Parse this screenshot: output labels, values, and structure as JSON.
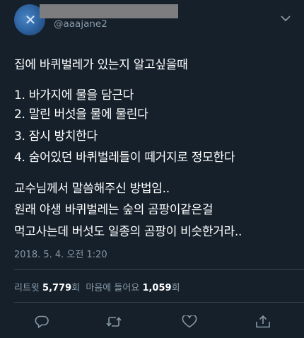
{
  "author": {
    "handle": "@aaajane2"
  },
  "tweet": {
    "lines": [
      "집에 바퀴벌레가 있는지 알고싶을때",
      "1. 바가지에 물을 담근다",
      "2. 말린 버섯을 물에 물린다",
      "3. 잠시 방치한다",
      "4. 숨어있던 바퀴벌레들이 떼거지로 정모한다",
      "교수님께서 말씀해주신 방법임..",
      "원래 야생 바퀴벌레는 숲의 곰팡이같은걸",
      "먹고사는데 버섯도 일종의 곰팡이 비슷한거라.."
    ],
    "timestamp": "2018. 5. 4. 오전 1:20"
  },
  "stats": {
    "retweets_label": "리트윗",
    "retweets_count": "5,779",
    "retweets_unit": "회",
    "likes_label": "마음에 들어요",
    "likes_count": "1,059",
    "likes_unit": "회"
  },
  "actions": {
    "icons": [
      "reply-icon",
      "retweet-icon",
      "like-icon",
      "share-icon"
    ]
  },
  "colors": {
    "background": "#15202b",
    "text": "#ffffff",
    "secondary_text": "#8899a6",
    "divider": "#38444d"
  }
}
